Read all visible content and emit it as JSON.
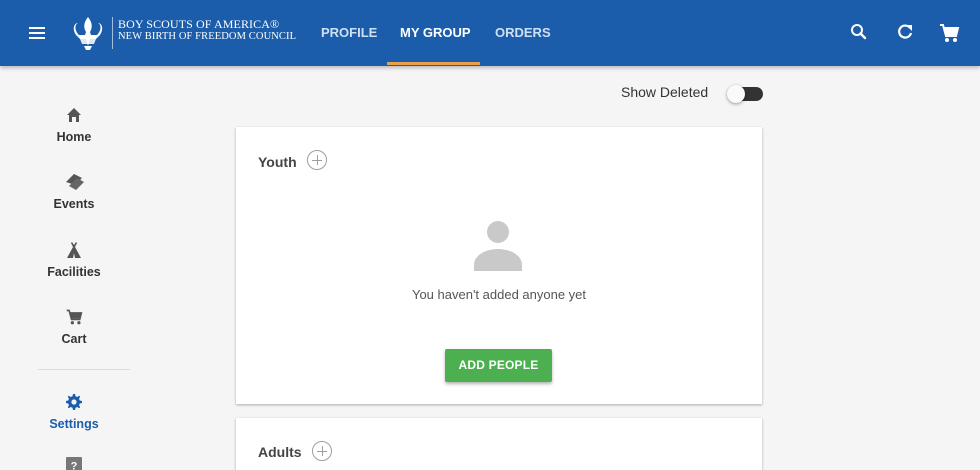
{
  "header": {
    "brand_line1": "BOY SCOUTS OF AMERICA®",
    "brand_line2": "NEW BIRTH OF FREEDOM COUNCIL",
    "tabs": [
      {
        "label": "PROFILE"
      },
      {
        "label": "MY GROUP",
        "active": true
      },
      {
        "label": "ORDERS"
      }
    ],
    "icons": [
      "menu-icon",
      "search-icon",
      "refresh-icon",
      "cart-icon"
    ]
  },
  "sidebar": {
    "items": [
      {
        "label": "Home",
        "icon": "home-icon"
      },
      {
        "label": "Events",
        "icon": "tickets-icon"
      },
      {
        "label": "Facilities",
        "icon": "tent-icon"
      },
      {
        "label": "Cart",
        "icon": "cart-icon"
      },
      {
        "label": "Settings",
        "icon": "gear-icon",
        "active": true
      },
      {
        "label": "",
        "icon": "help-icon"
      }
    ]
  },
  "main": {
    "show_deleted_label": "Show Deleted",
    "show_deleted_on": false,
    "youth": {
      "title": "Youth",
      "empty_text": "You haven't added anyone yet",
      "add_button": "ADD PEOPLE"
    },
    "adults": {
      "title": "Adults"
    }
  },
  "colors": {
    "header": "#1b5dab",
    "tab_underline": "#e8a04b",
    "add_button": "#4caf50",
    "active_nav": "#1b5dab"
  }
}
